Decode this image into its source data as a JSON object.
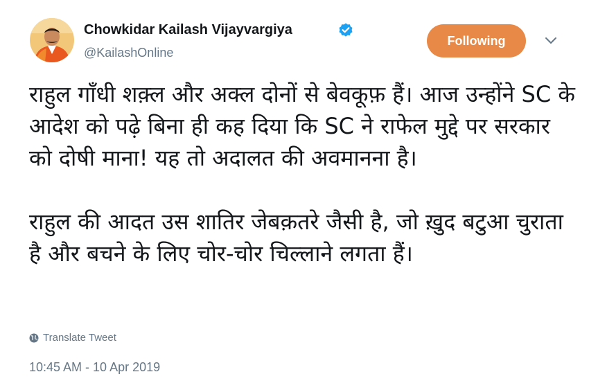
{
  "tweet": {
    "author": {
      "display_name": "Chowkidar Kailash Vijayvargiya",
      "handle": "@KailashOnline",
      "verified_icon": "verified-badge-icon",
      "avatar_icon": "profile-photo"
    },
    "follow_button_label": "Following",
    "menu_icon": "chevron-down-icon",
    "paragraphs": [
      "राहुल गाँधी शक़्ल और अक्ल दोनों से बेवकूफ़ हैं। आज उन्होंने SC के आदेश को पढ़े बिना ही कह दिया कि SC ने राफेल मुद्दे पर सरकार को दोषी माना! यह तो अदालत की अवमानना है।",
      "राहुल की आदत उस शातिर जेबक़तरे जैसी है, जो ख़ुद बटुआ चुराता है और बचने के लिए चोर-चोर चिल्लाने लगता हैं।"
    ],
    "translate_label": "Translate Tweet",
    "translate_icon": "globe-icon",
    "timestamp": "10:45 AM - 10 Apr 2019"
  },
  "colors": {
    "follow_button_bg": "#e88947",
    "verified": "#1da1f2",
    "secondary_text": "#657786",
    "primary_text": "#14171a"
  }
}
